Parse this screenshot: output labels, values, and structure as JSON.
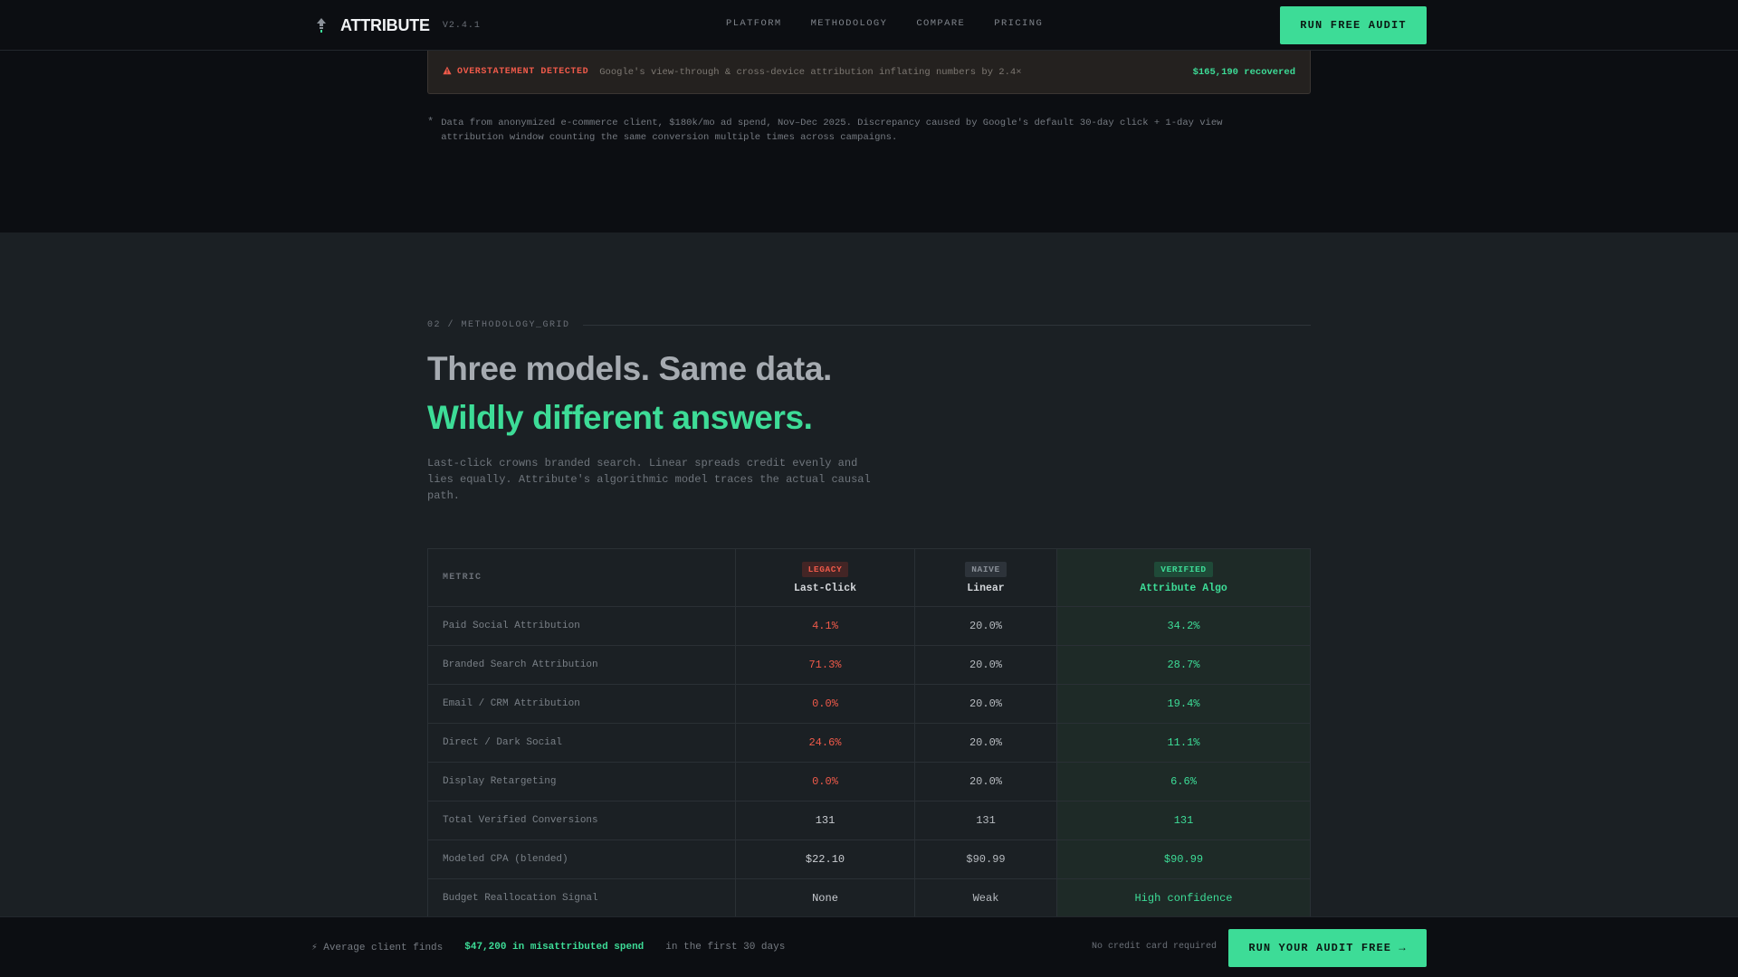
{
  "nav": {
    "brand": "ATTRIBUTE",
    "version": "V2.4.1",
    "links": [
      "PLATFORM",
      "METHODOLOGY",
      "COMPARE",
      "PRICING"
    ],
    "cta": "RUN FREE AUDIT",
    "logo_icon": "feather-arrow-icon"
  },
  "alert": {
    "icon": "warning-icon",
    "label": "OVERSTATEMENT DETECTED",
    "message": "Google's view-through & cross-device attribution inflating numbers by 2.4×",
    "recovered": "$165,190 recovered"
  },
  "footnote": {
    "marker": "*",
    "text": "Data from anonymized e-commerce client, $180k/mo ad spend, Nov–Dec 2025. Discrepancy caused by Google's default 30-day click + 1-day view attribution window counting the same conversion multiple times across campaigns."
  },
  "section": {
    "eyebrow": "02 / METHODOLOGY_GRID",
    "headline_1": "Three models. Same data.",
    "headline_2": "Wildly different answers.",
    "lede": "Last-click crowns branded search. Linear spreads credit evenly and lies equally. Attribute's algorithmic model traces the actual causal path."
  },
  "table": {
    "metric_header": "METRIC",
    "columns": [
      {
        "badge": "LEGACY",
        "name": "Last-Click"
      },
      {
        "badge": "NAIVE",
        "name": "Linear"
      },
      {
        "badge": "VERIFIED",
        "name": "Attribute Algo"
      }
    ],
    "rows": [
      {
        "metric": "Paid Social Attribution",
        "last_click": "4.1%",
        "linear": "20.0%",
        "algo": "34.2%"
      },
      {
        "metric": "Branded Search Attribution",
        "last_click": "71.3%",
        "linear": "20.0%",
        "algo": "28.7%"
      },
      {
        "metric": "Email / CRM Attribution",
        "last_click": "0.0%",
        "linear": "20.0%",
        "algo": "19.4%"
      },
      {
        "metric": "Direct / Dark Social",
        "last_click": "24.6%",
        "linear": "20.0%",
        "algo": "11.1%"
      },
      {
        "metric": "Display Retargeting",
        "last_click": "0.0%",
        "linear": "20.0%",
        "algo": "6.6%"
      },
      {
        "metric": "Total Verified Conversions",
        "last_click": "131",
        "linear": "131",
        "algo": "131"
      },
      {
        "metric": "Modeled CPA (blended)",
        "last_click": "$22.10",
        "linear": "$90.99",
        "algo": "$90.99"
      },
      {
        "metric": "Budget Reallocation Signal",
        "last_click": "None",
        "linear": "Weak",
        "algo": "High confidence"
      }
    ]
  },
  "bottom_bar": {
    "icon": "lightning-icon",
    "lead": "⚡ Average client finds",
    "highlight": "$47,200 in misattributed spend",
    "tail": "in the first 30 days",
    "note": "No credit card required",
    "cta": "RUN YOUR AUDIT FREE →"
  },
  "colors": {
    "accent": "#3ddc97",
    "danger": "#ef5a4a",
    "background": "#0c0e12",
    "section_bg": "#1b2024"
  }
}
